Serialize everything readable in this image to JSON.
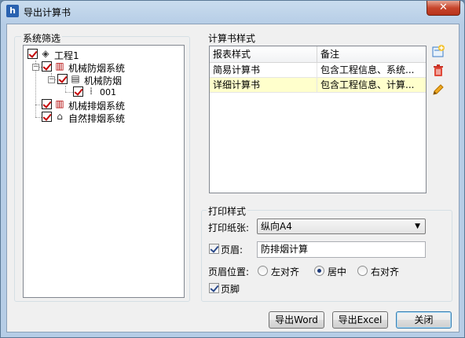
{
  "window": {
    "title": "导出计算书",
    "close_label": "✕"
  },
  "system_filter": {
    "label": "系统筛选",
    "tree": [
      {
        "label": "工程1",
        "level": 0,
        "expanded": true,
        "checked": true,
        "icon": "layers-icon"
      },
      {
        "label": "机械防烟系统",
        "level": 1,
        "expanded": true,
        "checked": true,
        "icon": "fan-system-icon"
      },
      {
        "label": "机械防烟",
        "level": 2,
        "expanded": true,
        "checked": true,
        "icon": "building-icon"
      },
      {
        "label": "001",
        "level": 3,
        "checked": true,
        "icon": "grid-node-icon"
      },
      {
        "label": "机械排烟系统",
        "level": 1,
        "checked": true,
        "icon": "exhaust-system-icon"
      },
      {
        "label": "自然排烟系统",
        "level": 1,
        "checked": true,
        "icon": "natural-vent-icon"
      }
    ]
  },
  "report_style": {
    "label": "计算书样式",
    "columns": [
      "报表样式",
      "备注"
    ],
    "rows": [
      {
        "name": "简易计算书",
        "note": "包含工程信息、系统...",
        "selected": false
      },
      {
        "name": "详细计算书",
        "note": "包含工程信息、计算...",
        "selected": true
      }
    ],
    "icons": [
      "add-icon",
      "delete-icon",
      "edit-icon"
    ]
  },
  "print_style": {
    "label": "打印样式",
    "paper_label": "打印纸张:",
    "paper_value": "纵向A4",
    "header_label": "页眉:",
    "header_checked": true,
    "header_value": "防排烟计算",
    "position_label": "页眉位置:",
    "position_options": [
      "左对齐",
      "居中",
      "右对齐"
    ],
    "position_selected": "居中",
    "footer_label": "页脚",
    "footer_checked": true
  },
  "buttons": {
    "export_word": "导出Word",
    "export_excel": "导出Excel",
    "close": "关闭"
  },
  "colors": {
    "title_bar": "#b6cde6",
    "close_button": "#c7462c",
    "selected_row": "#ffffcc",
    "check_mark": "#c40000"
  }
}
